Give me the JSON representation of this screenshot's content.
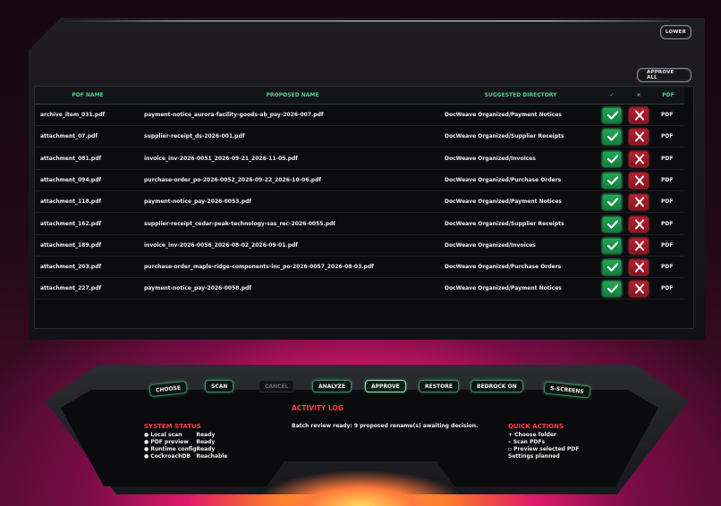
{
  "toolbar": {
    "lower_label": "LOWER",
    "approve_all_label": "APPROVE ALL"
  },
  "table": {
    "headers": {
      "pdf_name": "PDF NAME",
      "proposed_name": "PROPOSED NAME",
      "suggested_directory": "SUGGESTED DIRECTORY",
      "approve": "✓",
      "reject": "×",
      "type": "PDF"
    },
    "rows": [
      {
        "pdf": "archive_item_031.pdf",
        "proposed": "payment-notice_aurora-facility-goods-ab_pay-2026-007.pdf",
        "dir": "DocWeave Organized/Payment Notices",
        "type": "PDF"
      },
      {
        "pdf": "attachment_07.pdf",
        "proposed": "supplier-receipt_ds-2026-001.pdf",
        "dir": "DocWeave Organized/Supplier Receipts",
        "type": "PDF"
      },
      {
        "pdf": "attachment_081.pdf",
        "proposed": "invoice_inv-2026-0051_2026-09-21_2026-11-05.pdf",
        "dir": "DocWeave Organized/Invoices",
        "type": "PDF"
      },
      {
        "pdf": "attachment_094.pdf",
        "proposed": "purchase-order_po-2026-0052_2026-09-22_2026-10-06.pdf",
        "dir": "DocWeave Organized/Purchase Orders",
        "type": "PDF"
      },
      {
        "pdf": "attachment_118.pdf",
        "proposed": "payment-notice_pay-2026-0053.pdf",
        "dir": "DocWeave Organized/Payment Notices",
        "type": "PDF"
      },
      {
        "pdf": "attachment_162.pdf",
        "proposed": "supplier-receipt_cedar-peak-technology-sas_rec-2026-0055.pdf",
        "dir": "DocWeave Organized/Supplier Receipts",
        "type": "PDF"
      },
      {
        "pdf": "attachment_189.pdf",
        "proposed": "invoice_inv-2026-0056_2026-08-02_2026-09-01.pdf",
        "dir": "DocWeave Organized/Invoices",
        "type": "PDF"
      },
      {
        "pdf": "attachment_203.pdf",
        "proposed": "purchase-order_maple-ridge-components-inc_po-2026-0057_2026-08-03.pdf",
        "dir": "DocWeave Organized/Purchase Orders",
        "type": "PDF"
      },
      {
        "pdf": "attachment_227.pdf",
        "proposed": "payment-notice_pay-2026-0058.pdf",
        "dir": "DocWeave Organized/Payment Notices",
        "type": "PDF"
      }
    ]
  },
  "console": {
    "tabs": [
      {
        "label": "CHOOSE",
        "state": "normal"
      },
      {
        "label": "SCAN",
        "state": "normal"
      },
      {
        "label": "CANCEL",
        "state": "disabled"
      },
      {
        "label": "ANALYZE",
        "state": "normal"
      },
      {
        "label": "APPROVE",
        "state": "active"
      },
      {
        "label": "RESTORE",
        "state": "normal"
      },
      {
        "label": "BEDROCK ON",
        "state": "normal"
      },
      {
        "label": "S-SCREENS",
        "state": "normal"
      }
    ],
    "activity_log": {
      "title": "ACTIVITY LOG",
      "message": "Batch review ready: 9 proposed rename(s) awaiting decision."
    },
    "system_status": {
      "title": "SYSTEM STATUS",
      "items": [
        {
          "key": "Local scan",
          "value": "Ready"
        },
        {
          "key": "PDF preview",
          "value": "Ready"
        },
        {
          "key": "Runtime config",
          "value": "Ready"
        },
        {
          "key": "CockroachDB",
          "value": "Reachable"
        }
      ]
    },
    "quick_actions": {
      "title": "QUICK ACTIONS",
      "items": [
        "+ Choose folder",
        "⌁ Scan PDFs",
        "▫ Preview selected PDF",
        "Settings planned"
      ]
    }
  },
  "colors": {
    "accent_green": "#4ed389",
    "accent_red": "#ff3d4e",
    "approve_button": "#1f9a50",
    "reject_button": "#b01c2a"
  }
}
